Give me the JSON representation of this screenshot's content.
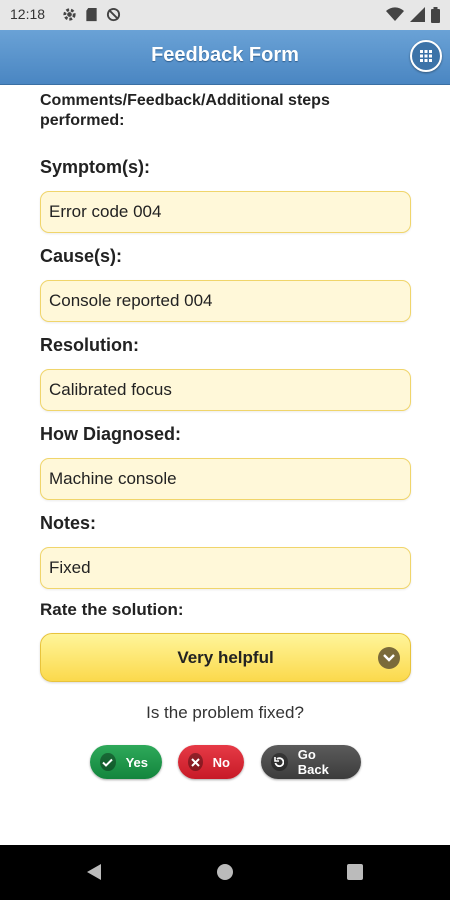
{
  "status_bar": {
    "time": "12:18",
    "left_icons": [
      "gear-icon",
      "sd-card-icon",
      "no-sync-icon"
    ],
    "right_icons": [
      "wifi-icon",
      "signal-icon",
      "battery-icon"
    ]
  },
  "header": {
    "title": "Feedback Form",
    "menu_icon": "grid-menu-icon",
    "color": "#5a94cc"
  },
  "form": {
    "intro": "Comments/Feedback/Additional steps performed:",
    "fields": [
      {
        "label": "Symptom(s):",
        "value": "Error code 004"
      },
      {
        "label": "Cause(s):",
        "value": "Console reported 004"
      },
      {
        "label": "Resolution:",
        "value": "Calibrated focus"
      },
      {
        "label": "How Diagnosed:",
        "value": "Machine console"
      },
      {
        "label": "Notes:",
        "value": "Fixed"
      }
    ],
    "rating_label": "Rate the solution:",
    "rating_value": "Very helpful",
    "question": "Is the problem fixed?"
  },
  "buttons": {
    "yes": "Yes",
    "no": "No",
    "back": "Go Back"
  },
  "colors": {
    "field_bg": "#fff8d9",
    "field_border": "#f0d56b",
    "yes": "#1d9448",
    "no": "#d62432",
    "back": "#474747"
  }
}
